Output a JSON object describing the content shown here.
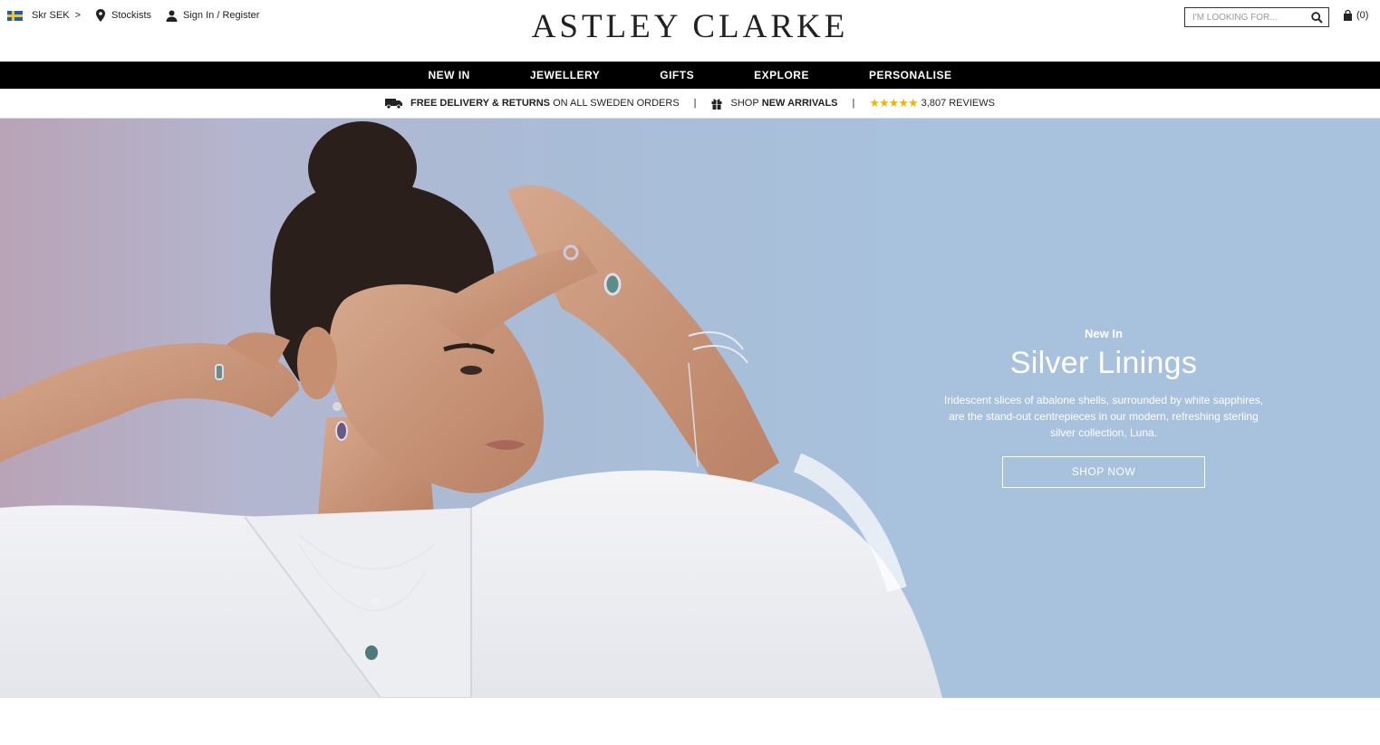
{
  "header": {
    "currency": "Skr SEK",
    "stockists": "Stockists",
    "account": "Sign In / Register",
    "logo": "ASTLEY CLARKE",
    "search_placeholder": "I'M LOOKING FOR...",
    "bag_count": "(0)"
  },
  "nav": {
    "items": [
      "NEW IN",
      "JEWELLERY",
      "GIFTS",
      "EXPLORE",
      "PERSONALISE"
    ]
  },
  "promo": {
    "delivery_bold": "FREE DELIVERY & RETURNS",
    "delivery_rest": "ON ALL SWEDEN ORDERS",
    "separator": "|",
    "shop_prefix": "SHOP",
    "shop_bold": "NEW ARRIVALS",
    "stars": "★★★★★",
    "reviews": "3,807 REVIEWS"
  },
  "hero": {
    "eyebrow": "New In",
    "title": "Silver Linings",
    "description": "Iridescent slices of abalone shells, surrounded by white sapphires, are the stand-out centrepieces in our modern, refreshing sterling silver collection, Luna.",
    "cta": "SHOP NOW"
  },
  "icons": {
    "flag": "sweden-flag-icon",
    "stockists": "map-pin-icon",
    "account": "user-icon",
    "search": "search-icon",
    "bag": "shopping-bag-icon",
    "delivery": "truck-icon",
    "gift": "gift-icon"
  },
  "colors": {
    "nav_bg": "#000000",
    "star": "#f0b400",
    "hero_bg": "#a8c2de"
  }
}
